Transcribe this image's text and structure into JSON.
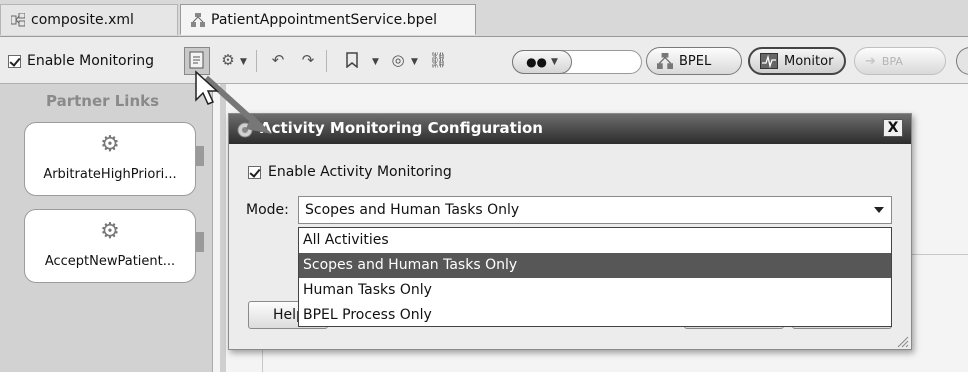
{
  "tabs": [
    {
      "label": "composite.xml",
      "icon": "composite-icon"
    },
    {
      "label": "PatientAppointmentService.bpel",
      "icon": "bpel-process-icon"
    }
  ],
  "toolbar": {
    "enable_monitoring_label": "Enable Monitoring",
    "enable_monitoring_checked": true,
    "bpel_button_label": "BPEL",
    "monitor_button_label": "Monitor",
    "bpa_button_label": "BPA"
  },
  "partner_links": {
    "title": "Partner Links",
    "items": [
      {
        "label": "ArbitrateHighPriori..."
      },
      {
        "label": "AcceptNewPatient..."
      }
    ]
  },
  "dialog": {
    "title": "Activity Monitoring Configuration",
    "close_label": "X",
    "enable_label": "Enable Activity Monitoring",
    "enable_checked": true,
    "mode_label": "Mode:",
    "mode_value": "Scopes and Human Tasks Only",
    "options": [
      {
        "label": "All Activities",
        "selected": false
      },
      {
        "label": "Scopes and Human Tasks Only",
        "selected": true
      },
      {
        "label": "Human Tasks Only",
        "selected": false
      },
      {
        "label": "BPEL Process Only",
        "selected": false
      }
    ],
    "help_label": "Help"
  },
  "colors": {
    "dialog_title_bar": "#3a3a3a",
    "selected_option": "#575757"
  }
}
